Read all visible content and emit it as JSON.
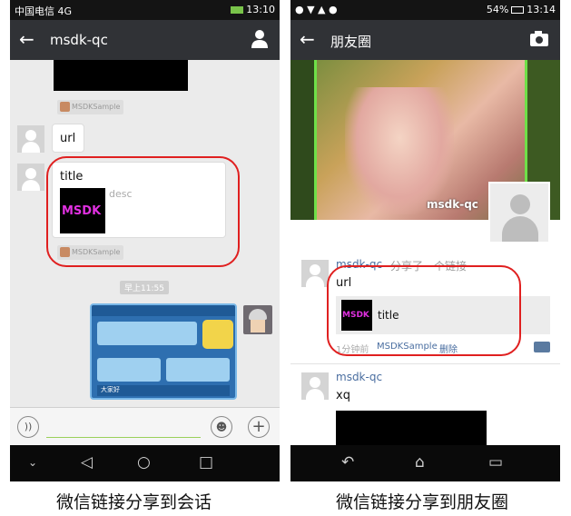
{
  "chat": {
    "status_left": "中国电信 4G",
    "status_right": "13:10",
    "title": "msdk-qc",
    "app_tag": "MSDKSample",
    "url_text": "url",
    "card_title": "title",
    "card_desc": "desc",
    "card_thumb_text": "MSDK",
    "time_label": "早上11:55",
    "game_label": "大家好"
  },
  "moments": {
    "status_right": "13:14",
    "battery": "54%",
    "title": "朋友圈",
    "cover_name": "msdk-qc",
    "post1": {
      "name": "msdk-qc",
      "action": "分享了一个链接",
      "text": "url",
      "link_title": "title",
      "link_thumb_text": "MSDK",
      "time": "1分钟前",
      "source": "MSDKSample",
      "delete": "删除"
    },
    "post2": {
      "name": "msdk-qc",
      "text": "xq"
    }
  },
  "captions": {
    "left": "微信链接分享到会话",
    "right": "微信链接分享到朋友圈"
  },
  "colors": {
    "titlebar": "#303236",
    "link_blue": "#4a6ea0",
    "highlight_red": "#e02020",
    "msdk_magenta": "#e030e0"
  },
  "icons": [
    "back-arrow-icon",
    "person-icon",
    "camera-icon",
    "voice-icon",
    "emoji-icon",
    "add-icon",
    "nav-back-icon",
    "nav-home-icon",
    "nav-recent-icon",
    "comment-icon"
  ]
}
